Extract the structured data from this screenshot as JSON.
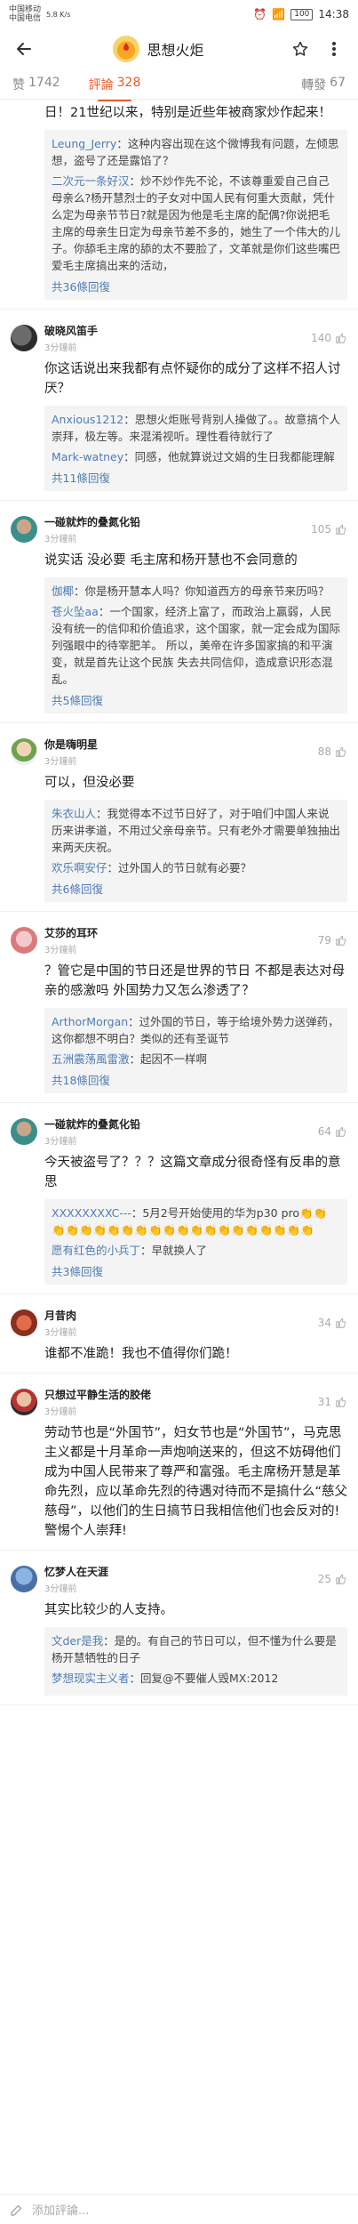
{
  "status": {
    "carrier1": "中国移动",
    "carrier2": "中国电信",
    "net": "5.8 K/s",
    "battery": "100",
    "time": "14:38"
  },
  "header": {
    "title": "思想火炬"
  },
  "tabs": {
    "likes_label": "赞",
    "likes_count": "1742",
    "comments_label": "評論",
    "comments_count": "328",
    "reposts_label": "轉發",
    "reposts_count": "67"
  },
  "top_fragment": {
    "text": "日！21世纪以来，特别是近些年被商家炒作起来！",
    "replies": [
      {
        "name": "Leung_Jerry",
        "text": "：这种内容出现在这个微博我有问题，左倾思想，盗号了还是露馅了？"
      },
      {
        "name": "二次元一条好汉",
        "text": "：炒不炒作先不论，不该尊重爱自己自己母亲么?杨开慧烈士的子女对中国人民有何重大贡献，凭什么定为母亲节节日?就是因为他是毛主席的配偶?你说把毛主席的母亲生日定为母亲节差不多的，她生了一个伟大的儿子。你舔毛主席的舔的太不要脸了，文革就是你们这些嘴巴爱毛主席搞出来的活动，"
      }
    ],
    "more": "共36條回復"
  },
  "comments": [
    {
      "name": "破晓风笛手",
      "time": "3分鐘前",
      "likes": "140",
      "text": "你这话说出来我都有点怀疑你的成分了这样不招人讨厌？",
      "replies": [
        {
          "name": "Anxious1212",
          "text": "：思想火炬账号背别人操做了。。故意搞个人崇拜，极左等。来混淆视听。理性看待就行了"
        },
        {
          "name": "Mark-watney",
          "text": "：同感，他就算说过文娟的生日我都能理解"
        }
      ],
      "more": "共11條回復"
    },
    {
      "name": "一碰就炸的叠氮化铅",
      "time": "3分鐘前",
      "likes": "105",
      "text": "说实话 没必要 毛主席和杨开慧也不会同意的",
      "replies": [
        {
          "name": "伽椰",
          "text": "：你是杨开慧本人吗？你知道西方的母亲节来历吗？"
        },
        {
          "name": "苍火坠aa",
          "text": "：一个国家，经济上富了，而政治上贏弱，人民没有统一的信仰和价值追求，这个国家，就一定会成为国际列强眼中的待宰肥羊。 所以，美帝在许多国家搞的和平演变，就是首先让这个民族 失去共同信仰，造成意识形态混乱。"
        }
      ],
      "more": "共5條回復"
    },
    {
      "name": "你是嗨明星",
      "time": "3分鐘前",
      "likes": "88",
      "text": "可以，但没必要",
      "replies": [
        {
          "name": "朱衣山人",
          "text": "：我觉得本不过节日好了，对于咱们中国人来说历来讲孝道，不用过父亲母亲节。只有老外才需要单独抽出来两天庆祝。"
        },
        {
          "name": "欢乐啊安仔",
          "text": "：过外国人的节日就有必要？"
        }
      ],
      "more": "共6條回復"
    },
    {
      "name": "艾莎的耳环",
      "time": "3分鐘前",
      "likes": "79",
      "text": "？管它是中国的节日还是世界的节日 不都是表达对母亲的感激吗 外国势力又怎么渗透了？",
      "replies": [
        {
          "name": "ArthorMorgan",
          "text": "：过外国的节日，等于给境外势力送弹药，这你都想不明白？类似的还有圣诞节"
        },
        {
          "name": "五洲震荡風雷激",
          "text": "：起因不一样啊"
        }
      ],
      "more": "共18條回復"
    },
    {
      "name": "一碰就炸的叠氮化铅",
      "time": "3分鐘前",
      "likes": "64",
      "text": "今天被盗号了？？？这篇文章成分很奇怪有反串的意思",
      "replies": [
        {
          "name": "XXXXXXXXC---",
          "text": "：5月2号开始使用的华为p30 pro👏👏👏👏👏👏👏👏👏👏👏👏👏👏👏👏👏👏👏👏👏"
        },
        {
          "name": "愿有红色的小兵丁",
          "text": "：早就换人了"
        }
      ],
      "more": "共3條回復"
    },
    {
      "name": "月昔肉",
      "time": "3分鐘前",
      "likes": "34",
      "text": "谁都不准跪！我也不值得你们跪！",
      "replies": [],
      "more": ""
    },
    {
      "name": "只想过平静生活的胶佬",
      "time": "3分鐘前",
      "likes": "31",
      "text": "劳动节也是“外国节”，妇女节也是“外国节”，马克思主义都是十月革命一声炮响送来的，但这不妨碍他们成为中国人民带来了尊严和富强。毛主席杨开慧是革命先烈，应以革命先烈的待遇对待而不是搞什么“慈父慈母”，以他们的生日搞节日我相信他们也会反对的!警惕个人崇拜!",
      "replies": [],
      "more": ""
    },
    {
      "name": "忆梦人在天涯",
      "time": "3分鐘前",
      "likes": "25",
      "text": "其实比较少的人支持。",
      "replies": [
        {
          "name": "文der是我",
          "text": "：是的。有自己的节日可以，但不懂为什么要是杨开慧牺牲的日子"
        },
        {
          "name": "梦想现实主义者",
          "text": "：回复@不要催人毁MX:2012"
        }
      ],
      "more": ""
    }
  ],
  "compose": {
    "placeholder": "添加評論..."
  }
}
